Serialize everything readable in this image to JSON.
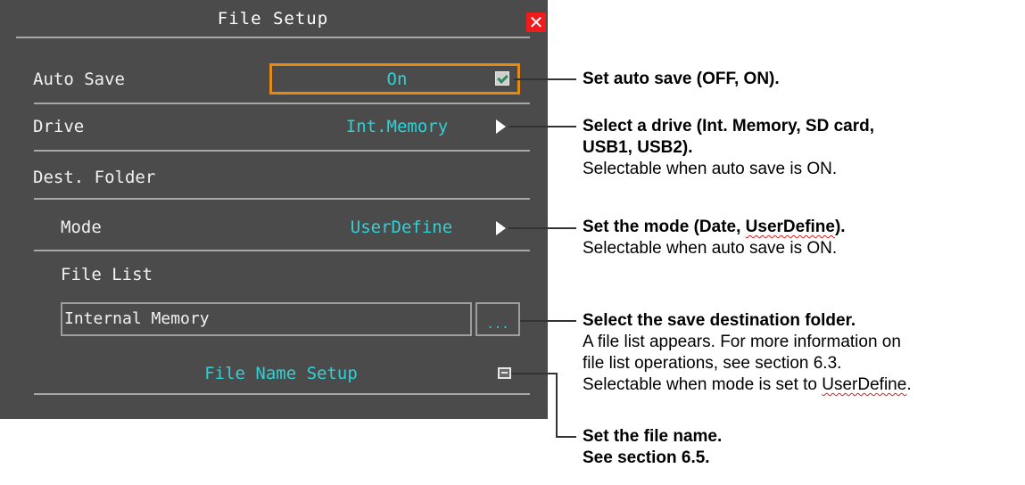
{
  "dialog": {
    "title": "File Setup",
    "close_icon": "close-x-icon",
    "auto_save": {
      "label": "Auto Save",
      "value": "On"
    },
    "drive": {
      "label": "Drive",
      "value": "Int.Memory"
    },
    "dest_folder": {
      "label": "Dest. Folder"
    },
    "mode": {
      "label": "Mode",
      "value": "UserDefine"
    },
    "file_list": {
      "label": "File List",
      "path": "Internal Memory",
      "browse_label": "..."
    },
    "file_name_setup": {
      "label": "File Name Setup"
    }
  },
  "annotations": {
    "auto_save": {
      "line1": "Set auto save (OFF, ON)."
    },
    "drive": {
      "line1": "Select a drive (Int. Memory, SD card,",
      "line2": "USB1, USB2).",
      "line3": "Selectable when auto save is ON."
    },
    "mode": {
      "line1_prefix": "Set the mode (Date, ",
      "line1_word": "UserDefine",
      "line1_suffix": ").",
      "line2": "Selectable when auto save is ON."
    },
    "folder": {
      "line1": "Select the save destination folder.",
      "line2": "A file list appears. For more information on",
      "line3": "file list operations, see section 6.3.",
      "line4_prefix": "Selectable when mode is set to ",
      "line4_word": "UserDefine",
      "line4_suffix": "."
    },
    "file_name": {
      "line1": "Set the file name.",
      "line2": "See section 6.5."
    }
  },
  "colors": {
    "panel_bg": "#4b4b4b",
    "value_text": "#2fd1d6",
    "focus_border": "#e58a12",
    "close_bg": "#ee1c1c"
  }
}
